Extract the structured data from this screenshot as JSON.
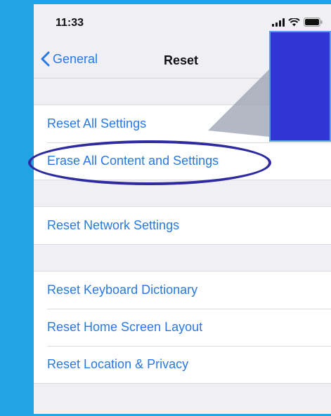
{
  "status_bar": {
    "time": "11:33",
    "icons": [
      "signal-icon",
      "wifi-icon",
      "battery-icon"
    ]
  },
  "nav": {
    "back_label": "General",
    "title": "Reset"
  },
  "groups": [
    [
      "Reset All Settings",
      "Erase All Content and Settings"
    ],
    [
      "Reset Network Settings"
    ],
    [
      "Reset Keyboard Dictionary",
      "Reset Home Screen Layout",
      "Reset Location & Privacy"
    ]
  ],
  "colors": {
    "frame": "#22a4e4",
    "link": "#2878e6",
    "callout": "#3135d4",
    "highlight_ellipse": "#2e2aa0"
  }
}
